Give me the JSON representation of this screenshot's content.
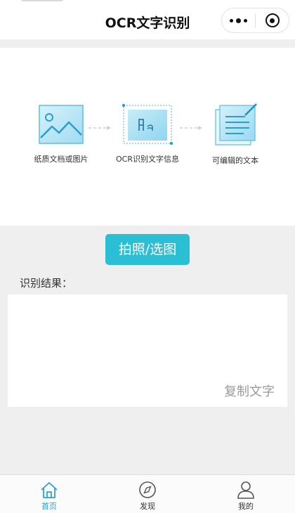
{
  "nav": {
    "title": "OCR文字识别"
  },
  "flow": {
    "steps": [
      {
        "caption": "纸质文档或图片",
        "icon": "picture-icon"
      },
      {
        "caption": "OCR识别文字信息",
        "icon": "text-scan-icon"
      },
      {
        "caption": "可编辑的文本",
        "icon": "editable-doc-icon"
      }
    ]
  },
  "action": {
    "label": "拍照/选图"
  },
  "result": {
    "label": "识别结果：",
    "text": "",
    "copy_label": "复制文字"
  },
  "tabbar": {
    "items": [
      {
        "label": "首页",
        "icon": "home-icon",
        "active": true
      },
      {
        "label": "发现",
        "icon": "compass-icon",
        "active": false
      },
      {
        "label": "我的",
        "icon": "user-icon",
        "active": false
      }
    ]
  },
  "colors": {
    "accent": "#2bbfd6",
    "tab_active": "#2f9fd6",
    "icon_blue": "#5bbfe0"
  }
}
